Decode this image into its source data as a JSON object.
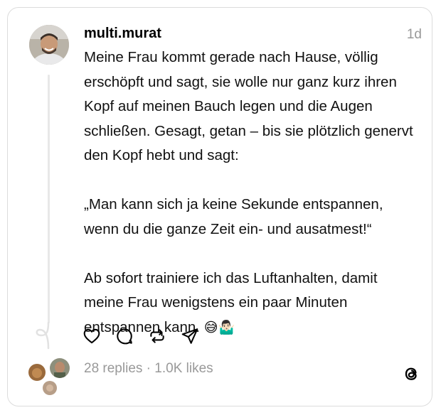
{
  "post": {
    "username": "multi.murat",
    "timestamp": "1d",
    "text": "Meine Frau kommt gerade nach Hause, völlig erschöpft und sagt, sie wolle nur ganz kurz ihren Kopf auf meinen Bauch legen und die Augen schließen. Gesagt, getan – bis sie plötzlich genervt den Kopf hebt und sagt:\n\n„Man kann sich ja keine Sekunde entspannen, wenn du die ganze Zeit ein- und ausatmest!“\n\nAb sofort trainiere ich das Luftanhalten, damit meine Frau wenigstens ein paar Minuten entspannen kann. ",
    "emojis": "😅🤷🏻‍♂️"
  },
  "stats": {
    "replies": "28 replies",
    "separator": " · ",
    "likes": "1.0K likes"
  },
  "icons": {
    "like": "heart-icon",
    "reply": "comment-icon",
    "repost": "repost-icon",
    "share": "send-icon",
    "brand": "threads-logo-icon"
  },
  "colors": {
    "border": "#dcdcdc",
    "secondary_text": "#999999",
    "thread_line": "#e8e8e8"
  }
}
